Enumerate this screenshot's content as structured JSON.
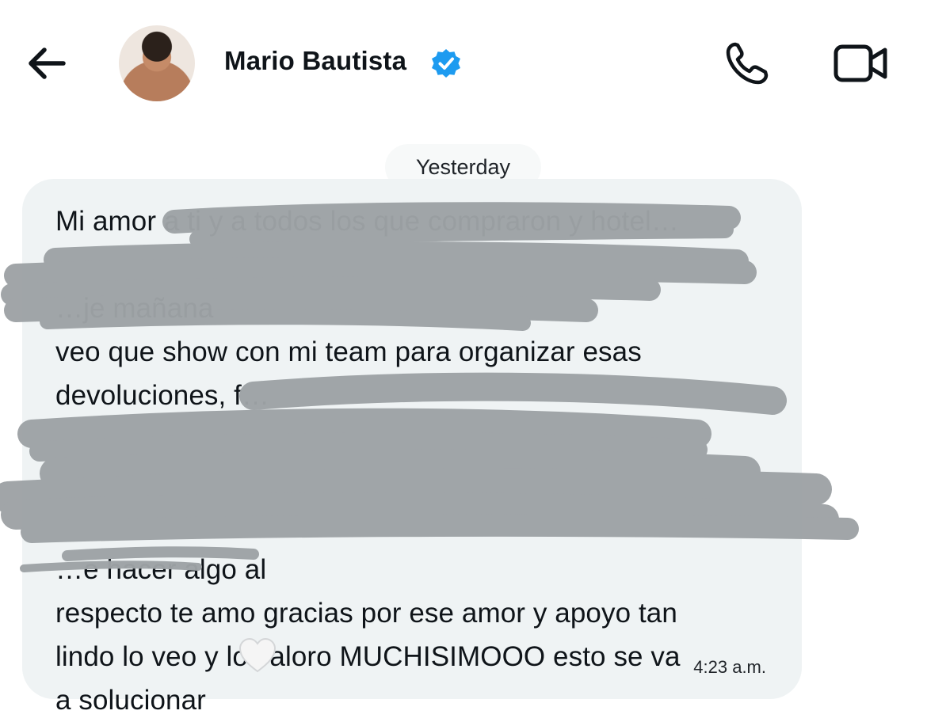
{
  "header": {
    "contact_name": "Mario Bautista",
    "verified": true,
    "icons": [
      "back-arrow-icon",
      "verified-badge-icon",
      "phone-icon",
      "video-camera-icon"
    ]
  },
  "conversation": {
    "date_separator": "Yesterday",
    "message": {
      "text": "Mi amor a ti y a todos los que compraron y hotel…\n\n…je mañana\nveo que show con mi team para organizar esas\ndevoluciones, f…\n\n\n\n…e hacer algo al\nrespecto te amo gracias por ese amor y apoyo tan\nlindo lo veo y lo valoro MUCHISIMOOO esto se va\na solucionar",
      "emoji": "white-heart",
      "time": "4:23 a.m.",
      "redacted": true
    }
  },
  "colors": {
    "bubble_background": "#eff3f4",
    "verified_blue": "#1d9bf0",
    "redaction_gray": "#9ea3a6"
  }
}
